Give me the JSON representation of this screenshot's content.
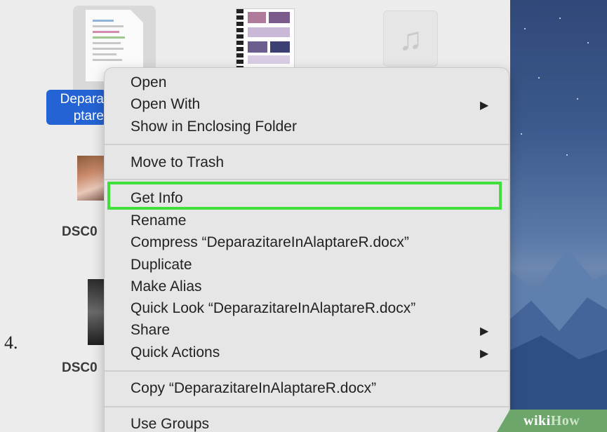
{
  "step_number": "4.",
  "desktop": {
    "selected_file_label_line1": "Depara",
    "selected_file_label_line2": "ptare",
    "file_label_dsc_1": "DSC0",
    "file_label_dsc_2": "DSC0"
  },
  "context_menu": {
    "items": [
      {
        "label": "Open"
      },
      {
        "label": "Open With",
        "submenu": true
      },
      {
        "label": "Show in Enclosing Folder"
      },
      {
        "label": "Move to Trash"
      },
      {
        "label": "Get Info",
        "highlighted": true
      },
      {
        "label": "Rename"
      },
      {
        "label": "Compress “DeparazitareInAlaptareR.docx”"
      },
      {
        "label": "Duplicate"
      },
      {
        "label": "Make Alias"
      },
      {
        "label": "Quick Look “DeparazitareInAlaptareR.docx”"
      },
      {
        "label": "Share",
        "submenu": true
      },
      {
        "label": "Quick Actions",
        "submenu": true
      },
      {
        "label": "Copy “DeparazitareInAlaptareR.docx”"
      },
      {
        "label": "Use Groups"
      }
    ],
    "submenu_arrow": "▶",
    "highlight_color": "#3fe03c"
  },
  "icons": {
    "document": "docx-file-icon",
    "photo": "photo-file-icon",
    "music": "music-note-icon",
    "music_glyph": "♫"
  },
  "watermark": {
    "part1": "wiki",
    "part2": "How"
  }
}
